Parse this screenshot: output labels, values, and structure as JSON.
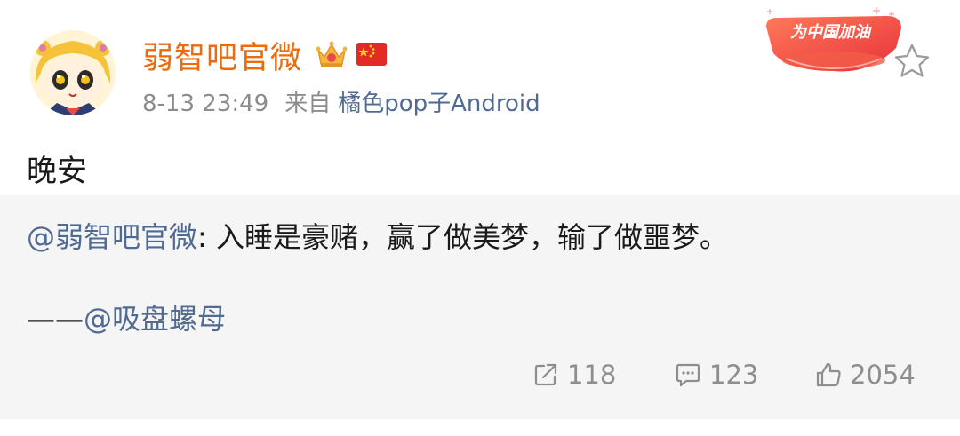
{
  "post": {
    "username": "弱智吧官微",
    "time": "8-13 23:49",
    "from_label": "来自",
    "device": "橘色pop子Android",
    "badge_text": "为中国加油",
    "text": "晚安"
  },
  "repost": {
    "mention": "@弱智吧官微",
    "separator": ":",
    "content": " 入睡是豪赌，赢了做美梦，输了做噩梦。",
    "signature_dash": "——",
    "signature_mention": "@吸盘螺母"
  },
  "actions": {
    "share_count": "118",
    "comment_count": "123",
    "like_count": "2054"
  },
  "colors": {
    "username": "#f06a0a",
    "link": "#506a91",
    "muted": "#8c8c8c",
    "repost_bg": "#f5f5f5"
  },
  "icons": [
    "avatar",
    "crown-vip-icon",
    "china-flag-icon",
    "cheer-badge",
    "star-icon",
    "share-icon",
    "comment-icon",
    "like-icon"
  ]
}
